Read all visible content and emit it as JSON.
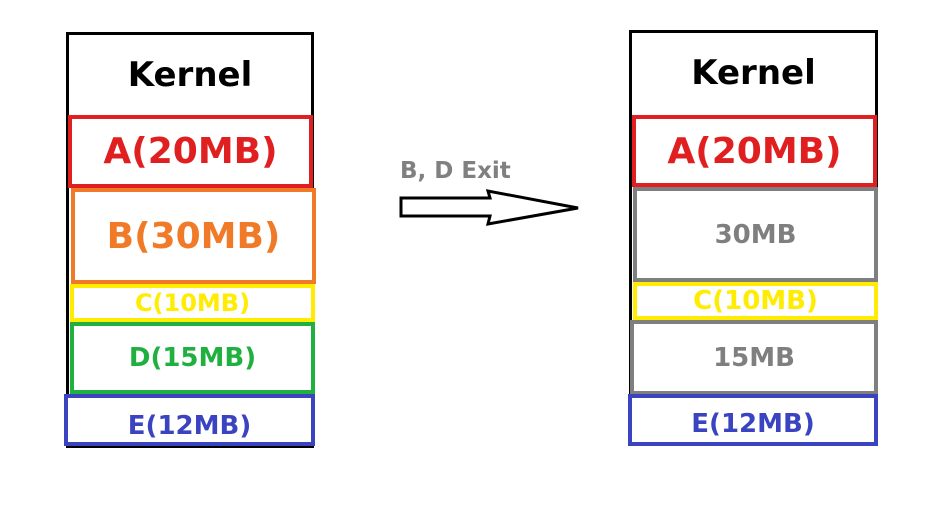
{
  "arrow": {
    "label": "B, D Exit"
  },
  "colors": {
    "kernel": "#000000",
    "A": "#e02020",
    "B": "#f07a28",
    "C": "#ffec00",
    "D": "#1fb040",
    "E": "#3a44c0",
    "free": "#7f7f7f"
  },
  "before": {
    "kernel": "Kernel",
    "A": "A(20MB)",
    "B": "B(30MB)",
    "C": "C(10MB)",
    "D": "D(15MB)",
    "E": "E(12MB)"
  },
  "after": {
    "kernel": "Kernel",
    "A": "A(20MB)",
    "hole1": "30MB",
    "C": "C(10MB)",
    "hole2": "15MB",
    "E": "E(12MB)"
  }
}
